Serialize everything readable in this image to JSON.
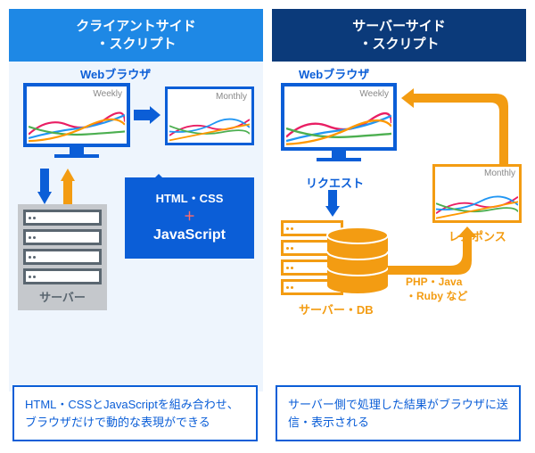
{
  "left": {
    "header": "クライアントサイド\n・スクリプト",
    "browser_label": "Webブラウザ",
    "chart1_tag": "Weekly",
    "chart2_tag": "Monthly",
    "server_label": "サーバー",
    "bubble_line1": "HTML・CSS",
    "bubble_plus": "＋",
    "bubble_line2": "JavaScript",
    "note": "HTML・CSSとJavaScriptを組み合わせ、ブラウザだけで動的な表現ができる"
  },
  "right": {
    "header": "サーバーサイド\n・スクリプト",
    "browser_label": "Webブラウザ",
    "chart1_tag": "Weekly",
    "chart2_tag": "Monthly",
    "request_label": "リクエスト",
    "response_label": "レスポンス",
    "server_label": "サーバー・DB",
    "lang_label": "PHP・Java\n・Ruby など",
    "note": "サーバー側で処理した結果がブラウザに送信・表示される"
  }
}
